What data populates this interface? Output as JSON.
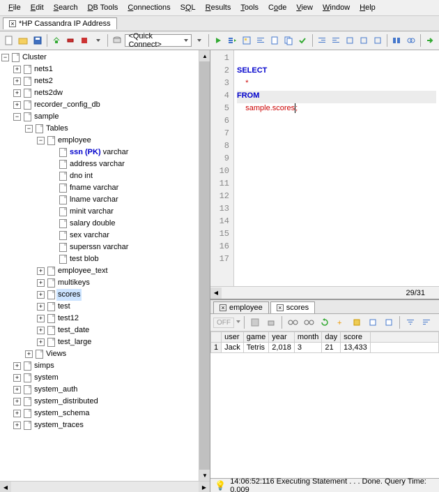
{
  "menu": [
    "File",
    "Edit",
    "Search",
    "DB Tools",
    "Connections",
    "SQL",
    "Results",
    "Tools",
    "Code",
    "View",
    "Window",
    "Help"
  ],
  "tab": {
    "title": "*HP Cassandra IP Address"
  },
  "quick_connect": "<Quick Connect>",
  "tree": {
    "root": "Cluster",
    "keyspaces": [
      "nets1",
      "nets2",
      "nets2dw",
      "recorder_config_db"
    ],
    "sample": {
      "label": "sample",
      "tables_label": "Tables",
      "employee": {
        "label": "employee",
        "cols": [
          {
            "name": "ssn (PK)",
            "type": "varchar",
            "pk": true
          },
          {
            "name": "address",
            "type": "varchar"
          },
          {
            "name": "dno",
            "type": "int"
          },
          {
            "name": "fname",
            "type": "varchar"
          },
          {
            "name": "lname",
            "type": "varchar"
          },
          {
            "name": "minit",
            "type": "varchar"
          },
          {
            "name": "salary",
            "type": "double"
          },
          {
            "name": "sex",
            "type": "varchar"
          },
          {
            "name": "superssn",
            "type": "varchar"
          },
          {
            "name": "test",
            "type": "blob"
          }
        ]
      },
      "other_tables": [
        "employee_text",
        "multikeys",
        "scores",
        "test",
        "test12",
        "test_date",
        "test_large"
      ],
      "views_label": "Views"
    },
    "bottom": [
      "simps",
      "system",
      "system_auth",
      "system_distributed",
      "system_schema",
      "system_traces"
    ]
  },
  "sql": {
    "lines": [
      "SELECT",
      "    *",
      "FROM",
      "    sample.scores;",
      "",
      "",
      "",
      "",
      "",
      "",
      "",
      "",
      "",
      "",
      "",
      "",
      ""
    ],
    "line_count": 17,
    "pos": "29/31"
  },
  "result_tabs": [
    "employee",
    "scores"
  ],
  "off_label": "OFF",
  "grid": {
    "headers": [
      "user",
      "game",
      "year",
      "month",
      "day",
      "score"
    ],
    "rows": [
      {
        "n": "1",
        "cells": [
          "Jack",
          "Tetris",
          "2,018",
          "3",
          "21",
          "13,433"
        ]
      }
    ]
  },
  "status": "14:06:52:116 Executing Statement . . . Done. Query Time: 0.009"
}
